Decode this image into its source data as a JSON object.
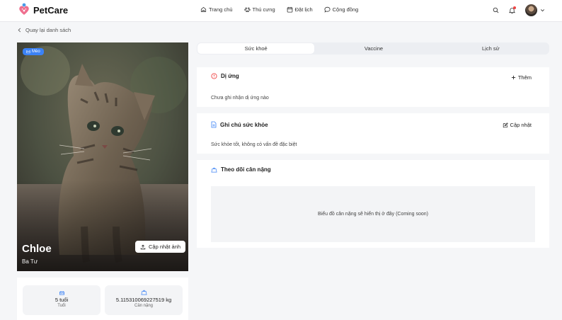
{
  "brand": {
    "name": "PetCare"
  },
  "nav": [
    {
      "label": "Trang chủ",
      "icon": "home-icon"
    },
    {
      "label": "Thú cưng",
      "icon": "paw-icon"
    },
    {
      "label": "Đặt lịch",
      "icon": "calendar-icon"
    },
    {
      "label": "Cộng đồng",
      "icon": "chat-icon"
    }
  ],
  "back": {
    "label": "Quay lại danh sách"
  },
  "pet": {
    "badge": "Mèo",
    "name": "Chloe",
    "breed": "Ba Tư",
    "update_photo_label": "Cập nhật ảnh",
    "age_value": "5 tuổi",
    "age_label": "Tuổi",
    "weight_value": "5.115310069227519 kg",
    "weight_label": "Cân nặng"
  },
  "tabs": [
    {
      "label": "Sức khoẻ",
      "active": true
    },
    {
      "label": "Vaccine",
      "active": false
    },
    {
      "label": "Lịch sử",
      "active": false
    }
  ],
  "allergy": {
    "title": "Dị ứng",
    "action": "Thêm",
    "text": "Chưa ghi nhận dị ứng nào"
  },
  "health_note": {
    "title": "Ghi chú sức khỏe",
    "action": "Cập nhật",
    "text": "Sức khỏe tốt, không có vấn đề đặc biệt"
  },
  "weight_tracking": {
    "title": "Theo dõi cân nặng",
    "placeholder": "Biểu đồ cân nặng sẽ hiển thị ở đây (Coming soon)"
  },
  "colors": {
    "accent": "#3b82f6",
    "danger": "#ef4444",
    "background": "#f5f6f8"
  }
}
